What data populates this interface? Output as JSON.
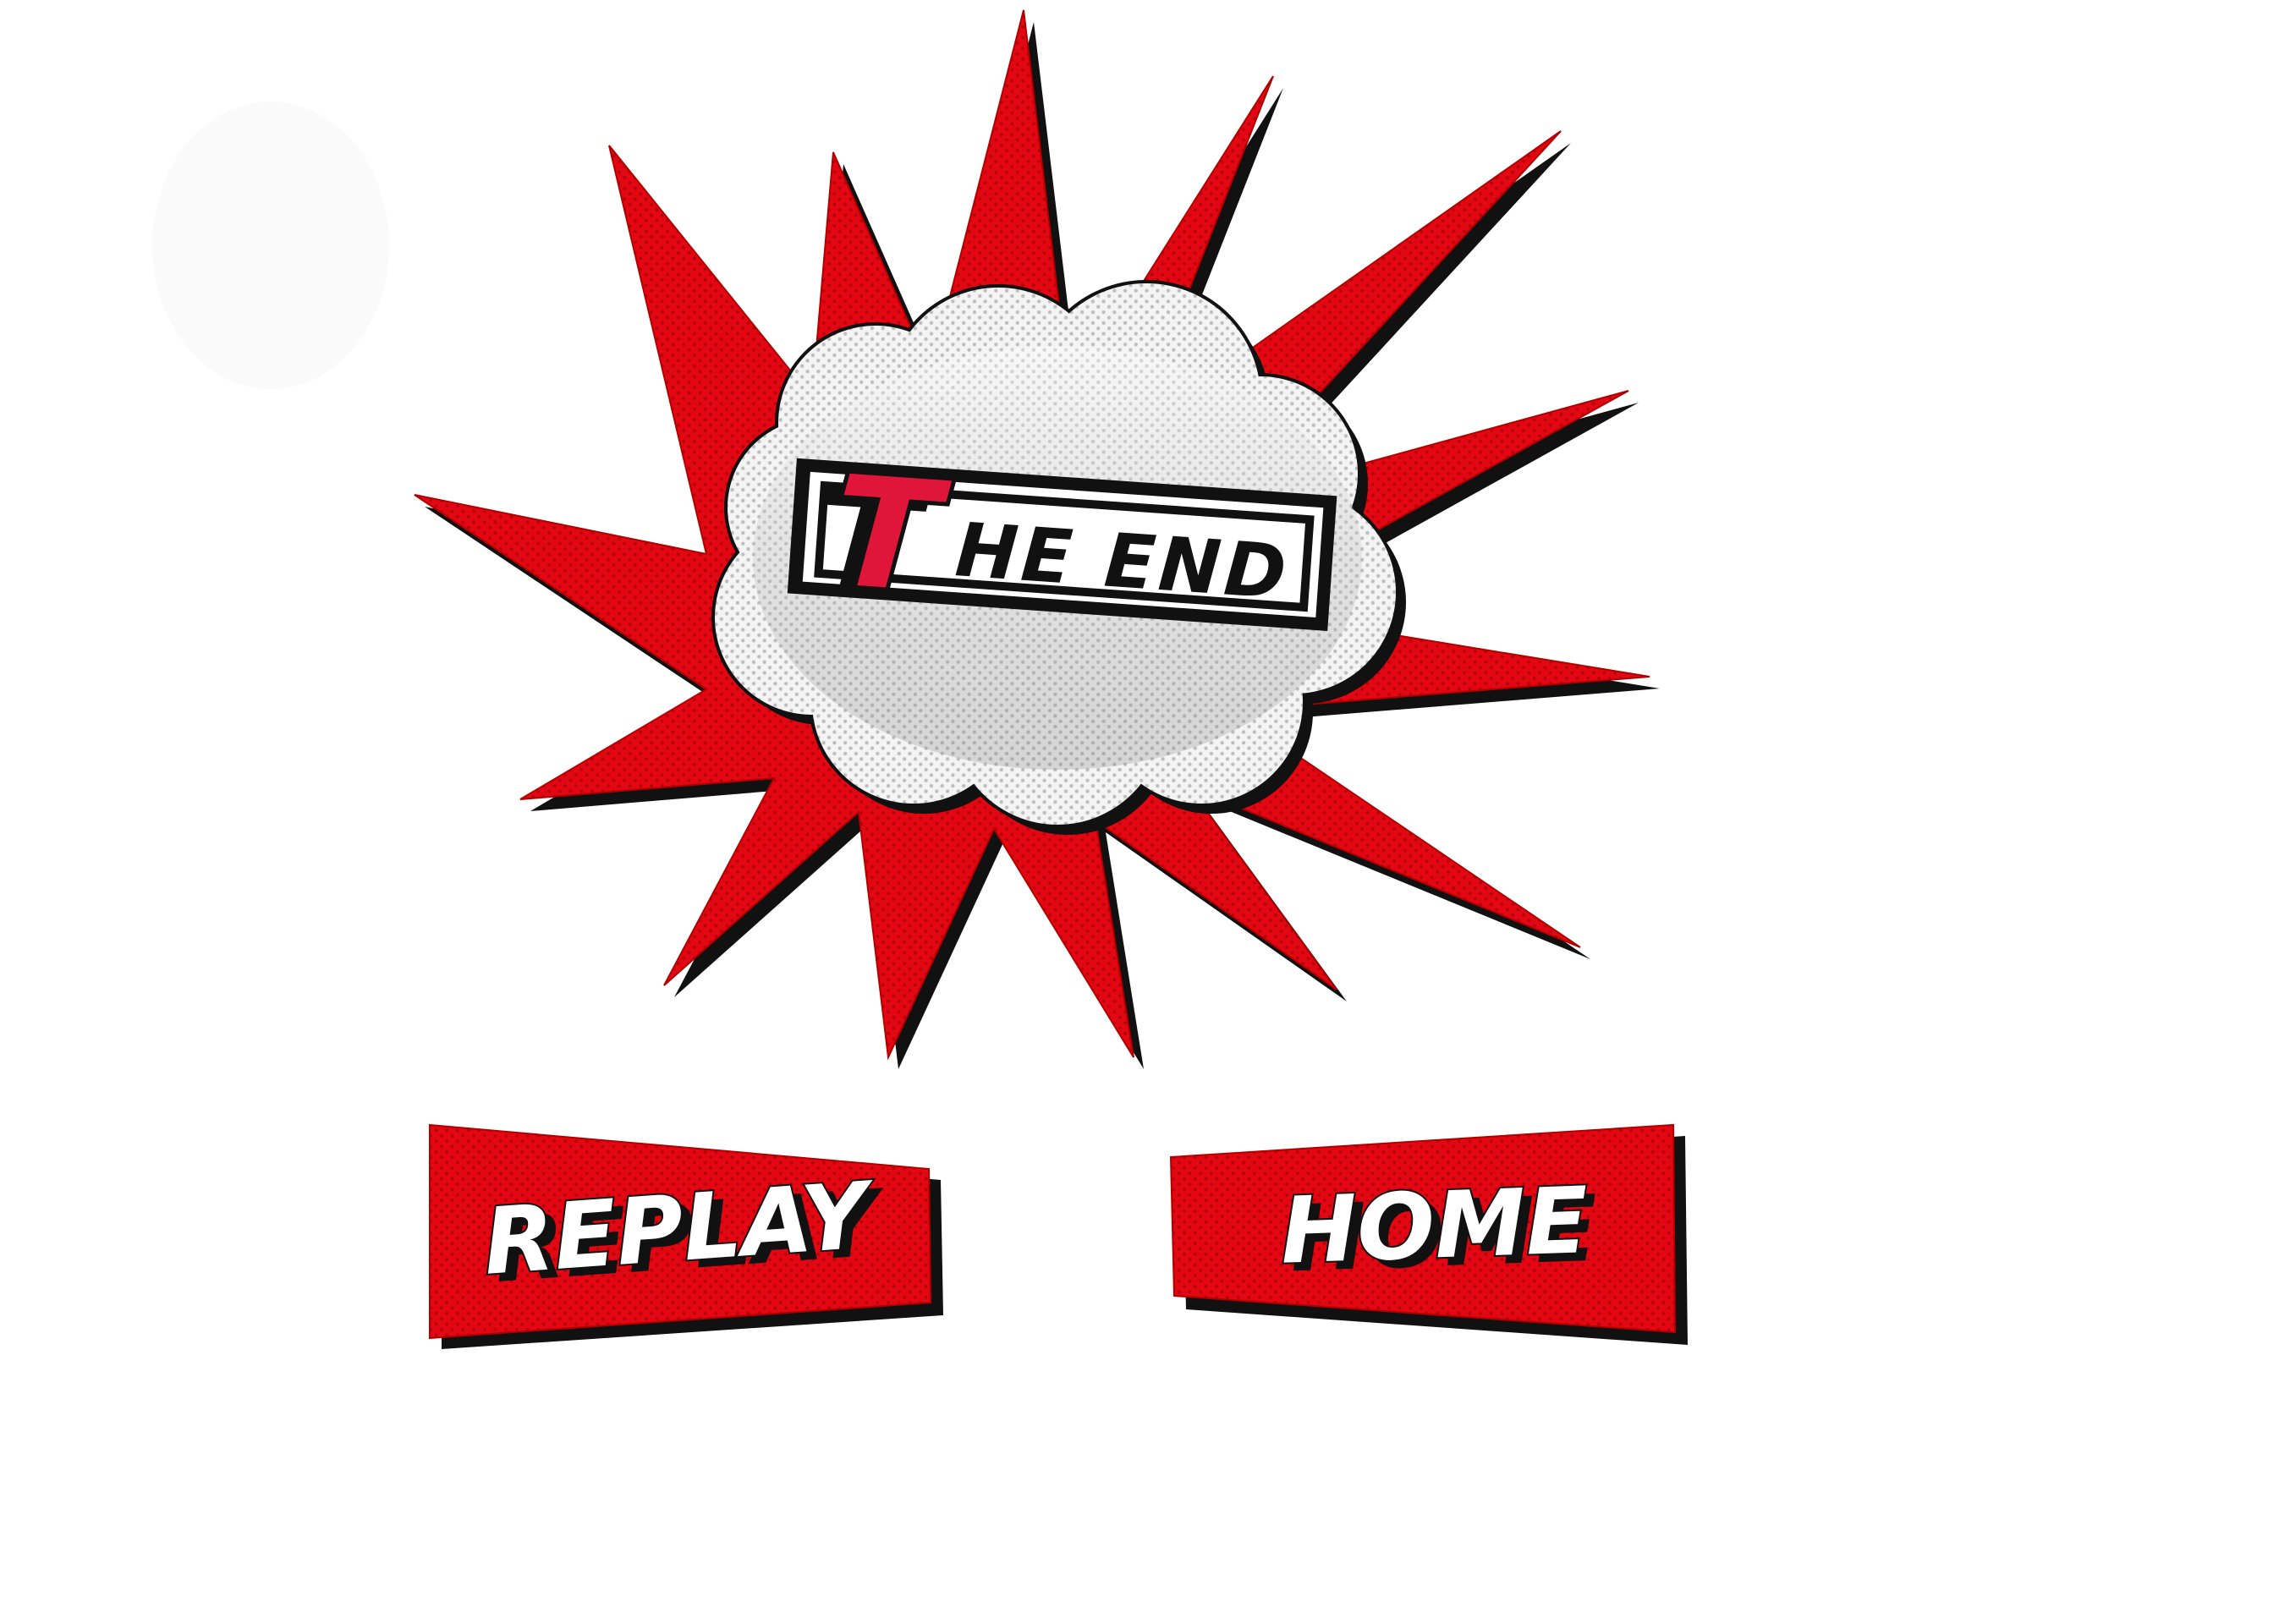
{
  "end_screen": {
    "title_initial": "T",
    "title_rest": "HE END"
  },
  "buttons": {
    "replay_label": "REPLAY",
    "home_label": "HOME"
  },
  "colors": {
    "burst_red": "#e30613",
    "title_accent": "#e0153a",
    "outline": "#111111",
    "cloud_grey": "#e2e2e2",
    "button_text": "#ffffff"
  }
}
